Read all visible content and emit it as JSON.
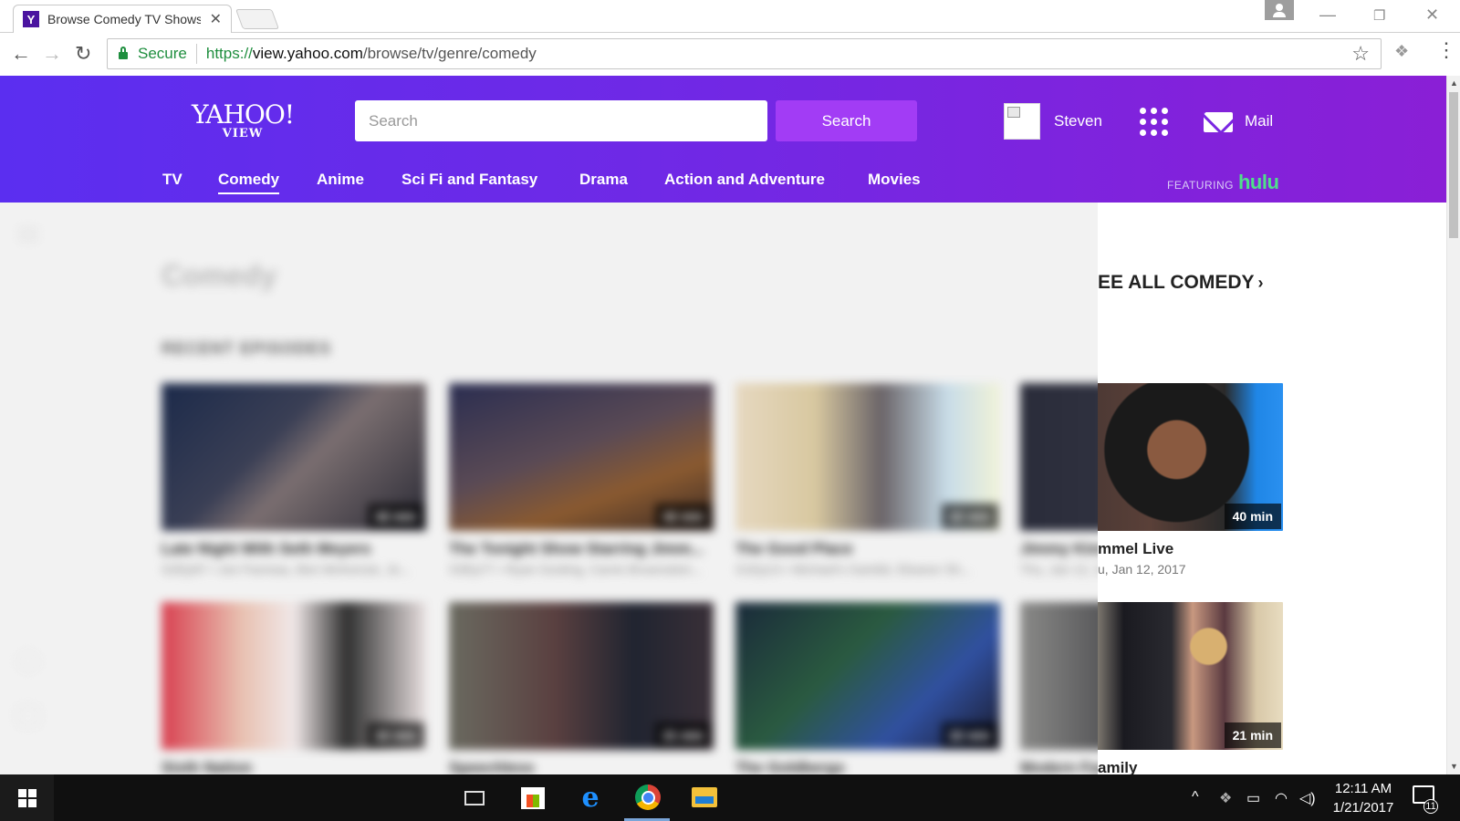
{
  "browser": {
    "tab_title": "Browse Comedy TV Shows",
    "tab_favicon": "Y",
    "secure_label": "Secure",
    "url_scheme": "https://",
    "url_host": "view.yahoo.com",
    "url_path": "/browse/tv/genre/comedy"
  },
  "header": {
    "logo_main": "YAHOO!",
    "logo_sub": "VIEW",
    "search_placeholder": "Search",
    "search_button": "Search",
    "username": "Steven",
    "mail_label": "Mail",
    "featuring_label": "FEATURING",
    "partner": "hulu",
    "colors": {
      "gradient_start": "#5b2ef0",
      "gradient_end": "#8a1fd6",
      "search_button": "#a23cf5",
      "hulu": "#4fe08a"
    }
  },
  "nav": {
    "items": [
      "TV",
      "Comedy",
      "Anime",
      "Sci Fi and Fantasy",
      "Drama",
      "Action and Adventure",
      "Movies"
    ],
    "active": "Comedy"
  },
  "main": {
    "page_title": "Comedy",
    "see_all": "EE ALL COMEDY",
    "recent_label": "RECENT EPISODES",
    "row1": [
      {
        "title": "Late Night With Seth Meyers",
        "sub": "S2Ep97 • Jon Favreau, Ben McKenzie, Jo...",
        "badge": "42 min"
      },
      {
        "title": "The Tonight Show Starring Jimm...",
        "sub": "S3Ep77 • Ryan Gosling, Carrie Brownstein...",
        "badge": "42 min"
      },
      {
        "title": "The Good Place",
        "sub": "S1Ep13 • Michael's Gambit, Eleanor Sh...",
        "badge": "22 min"
      },
      {
        "title": "Jimmy Kimmel Live",
        "sub": "Thu, Jan 12, 2017",
        "badge": "40 min"
      }
    ],
    "row2": [
      {
        "title": "Sixth Nation",
        "badge": "22 min"
      },
      {
        "title": "Speechless",
        "badge": "21 min"
      },
      {
        "title": "The Goldbergs",
        "badge": "22 min"
      },
      {
        "title": "Modern Family",
        "badge": "21 min"
      }
    ],
    "visible_right": {
      "card1_title": "mmel Live",
      "card1_sub": "u, Jan 12, 2017",
      "card1_badge": "40 min",
      "card2_title": "amily",
      "card2_badge": "21 min"
    }
  },
  "taskbar": {
    "time": "12:11 AM",
    "date": "1/21/2017",
    "notification_count": "11",
    "icons": [
      "start-icon",
      "task-view-icon",
      "store-icon",
      "edge-icon",
      "chrome-icon",
      "file-explorer-icon"
    ]
  }
}
